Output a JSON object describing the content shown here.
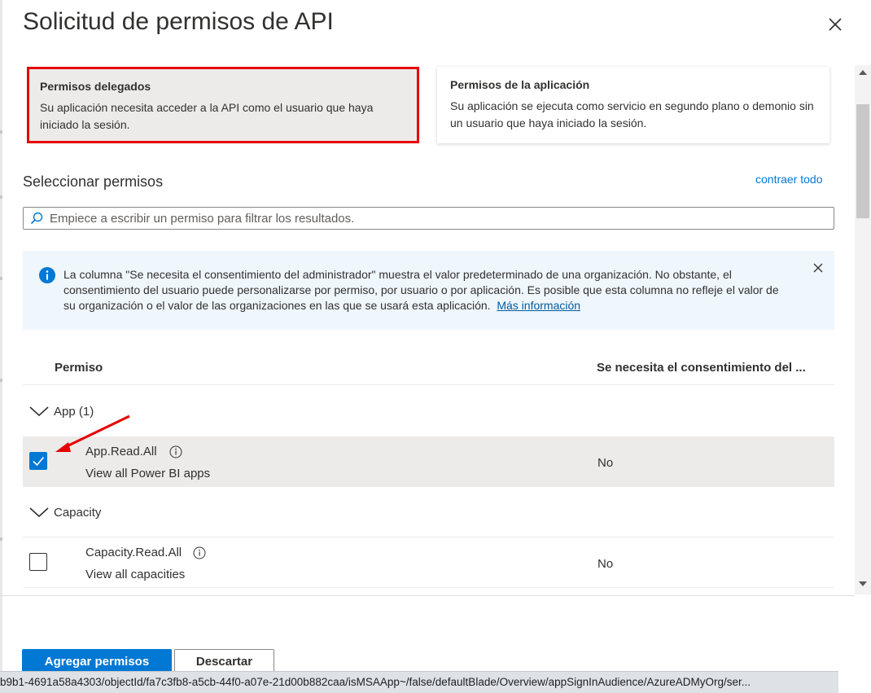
{
  "dialog": {
    "title": "Solicitud de permisos de API"
  },
  "permission_types": [
    {
      "title": "Permisos delegados",
      "description": "Su aplicación necesita acceder a la API como el usuario que haya iniciado la sesión.",
      "selected": true,
      "highlight_color": "#e60000"
    },
    {
      "title": "Permisos de la aplicación",
      "description": "Su aplicación se ejecuta como servicio en segundo plano o demonio sin un usuario que haya iniciado la sesión.",
      "selected": false
    }
  ],
  "select_permissions": {
    "heading": "Seleccionar permisos",
    "collapse_all": "contraer todo",
    "search_placeholder": "Empiece a escribir un permiso para filtrar los resultados."
  },
  "info_banner": {
    "text": "La columna \"Se necesita el consentimiento del administrador\" muestra el valor predeterminado de una organización. No obstante, el consentimiento del usuario puede personalizarse por permiso, por usuario o por aplicación. Es posible que esta columna no refleje el valor de su organización o el valor de las organizaciones en las que se usará esta aplicación.",
    "link": "Más información"
  },
  "table": {
    "columns": [
      "Permiso",
      "Se necesita el consentimiento del ..."
    ],
    "groups": [
      {
        "label": "App (1)",
        "permissions": [
          {
            "name": "App.Read.All",
            "description": "View all Power BI apps",
            "admin_consent": "No",
            "checked": true
          }
        ]
      },
      {
        "label": "Capacity",
        "permissions": [
          {
            "name": "Capacity.Read.All",
            "description": "View all capacities",
            "admin_consent": "No",
            "checked": false
          }
        ]
      }
    ]
  },
  "footer": {
    "primary": "Agregar permisos",
    "secondary": "Descartar"
  },
  "status_bar": {
    "url": "b9b1-4691a58a4303/objectId/fa7c3fb8-a5cb-44f0-a07e-21d00b882caa/isMSAApp~/false/defaultBlade/Overview/appSignInAudience/AzureADMyOrg/ser..."
  },
  "colors": {
    "accent": "#0078d4",
    "annotation": "#e60000"
  }
}
